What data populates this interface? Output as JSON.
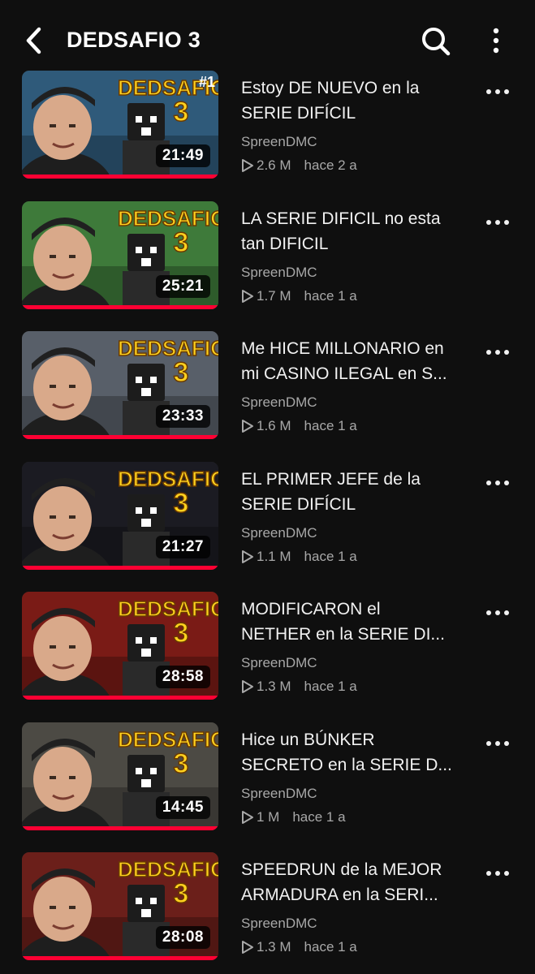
{
  "header": {
    "title": "DEDSAFIO 3",
    "icons": {
      "back": "back-arrow-icon",
      "search": "search-icon",
      "menu": "more-vertical-icon"
    }
  },
  "videos": [
    {
      "title_line1": "Estoy DE NUEVO en la",
      "title_line2": "SERIE DIFÍCIL",
      "channel": "SpreenDMC",
      "views": "2.6 M",
      "age": "hace 2 a",
      "duration": "21:49",
      "thumb_badge": "DEDSAFIO",
      "thumb_number": "3",
      "episode": "#1",
      "bg": "#2f5a7a",
      "accent": "#ffd21f"
    },
    {
      "title_line1": "LA SERIE DIFICIL no esta",
      "title_line2": "tan DIFICIL",
      "channel": "SpreenDMC",
      "views": "1.7 M",
      "age": "hace 1 a",
      "duration": "25:21",
      "thumb_badge": "DEDSAFIO",
      "thumb_number": "3",
      "episode": "",
      "bg": "#3e7a3a",
      "accent": "#ffd21f"
    },
    {
      "title_line1": "Me HICE MILLONARIO en",
      "title_line2": "mi CASINO ILEGAL en S...",
      "channel": "SpreenDMC",
      "views": "1.6 M",
      "age": "hace 1 a",
      "duration": "23:33",
      "thumb_badge": "DEDSAFIO",
      "thumb_number": "3",
      "episode": "",
      "bg": "#585f69",
      "accent": "#ffd21f"
    },
    {
      "title_line1": "EL PRIMER JEFE de la",
      "title_line2": "SERIE DIFÍCIL",
      "channel": "SpreenDMC",
      "views": "1.1 M",
      "age": "hace 1 a",
      "duration": "21:27",
      "thumb_badge": "DEDSAFIO",
      "thumb_number": "3",
      "episode": "",
      "bg": "#1b1b22",
      "accent": "#ffd21f"
    },
    {
      "title_line1": "MODIFICARON el",
      "title_line2": "NETHER en la SERIE DI...",
      "channel": "SpreenDMC",
      "views": "1.3 M",
      "age": "hace 1 a",
      "duration": "28:58",
      "thumb_badge": "DEDSAFIO",
      "thumb_number": "3",
      "episode": "",
      "bg": "#7a1b16",
      "accent": "#ffd21f"
    },
    {
      "title_line1": "Hice un BÚNKER",
      "title_line2": "SECRETO en la SERIE D...",
      "channel": "SpreenDMC",
      "views": "1 M",
      "age": "hace 1 a",
      "duration": "14:45",
      "thumb_badge": "DEDSAFIO",
      "thumb_number": "3",
      "episode": "",
      "bg": "#4c4a44",
      "accent": "#ffd21f"
    },
    {
      "title_line1": "SPEEDRUN de la MEJOR",
      "title_line2": "ARMADURA en la SERI...",
      "channel": "SpreenDMC",
      "views": "1.3 M",
      "age": "hace 1 a",
      "duration": "28:08",
      "thumb_badge": "DEDSAFIO",
      "thumb_number": "3",
      "episode": "",
      "bg": "#6b1f1a",
      "accent": "#ffd21f"
    }
  ]
}
